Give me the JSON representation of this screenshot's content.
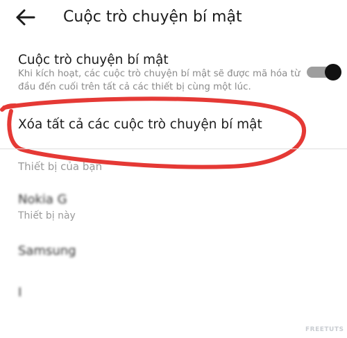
{
  "header": {
    "back_icon": "arrow-left-icon",
    "title": "Cuộc trò chuyện bí mật"
  },
  "secret_setting": {
    "title": "Cuộc trò chuyện bí mật",
    "description": "Khi kích hoạt, các cuộc trò chuyện bí mật sẽ được mã hóa từ đầu đến cuối trên tất cả các thiết bị cùng một lúc.",
    "toggle_on": true
  },
  "delete_all": {
    "label": "Xóa tất cả các cuộc trò chuyện bí mật",
    "annotation_color": "#e53935"
  },
  "devices": {
    "heading": "Thiết bị của bạn",
    "current_device_label": "Thiết bị này",
    "items": [
      {
        "name": "Nokia G",
        "note": "partially obscured"
      },
      {
        "name": "Samsung",
        "note": "partially obscured"
      },
      {
        "name": "I",
        "note": "partially obscured"
      }
    ]
  },
  "watermark": "FREETUTS"
}
